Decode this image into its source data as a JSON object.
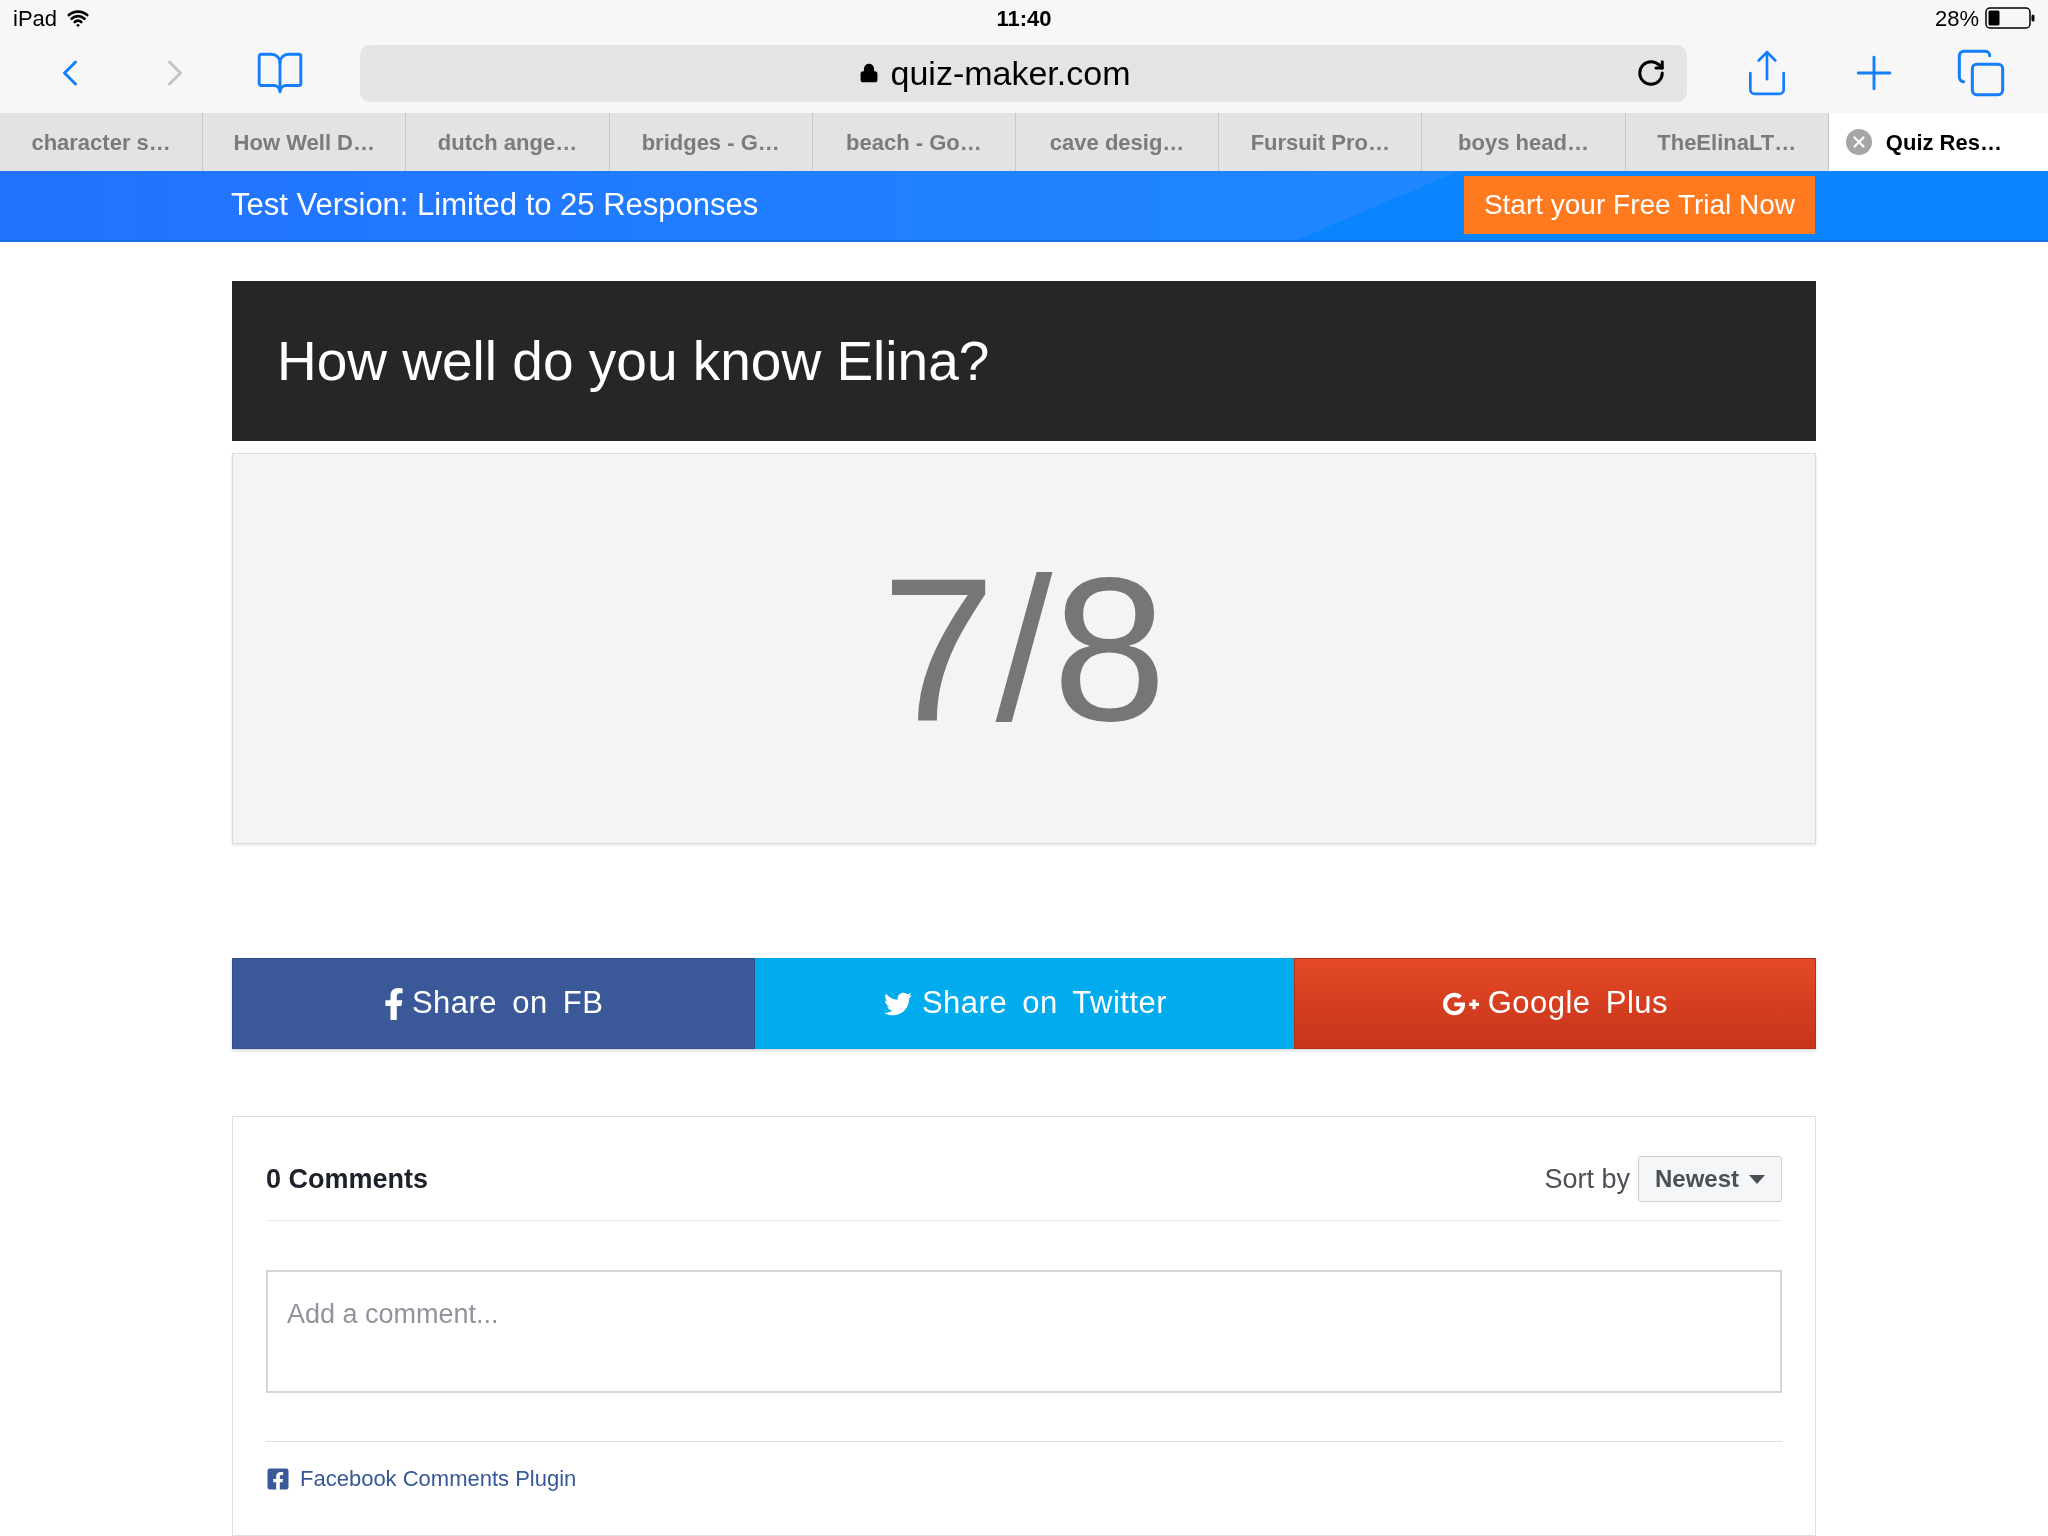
{
  "status_bar": {
    "device": "iPad",
    "time": "11:40",
    "battery": "28%"
  },
  "toolbar": {
    "nav": [
      {
        "kind": "back",
        "disabled": false
      },
      {
        "kind": "forward",
        "disabled": true
      }
    ],
    "url": "quiz-maker.com"
  },
  "tabs": [
    {
      "label": "character s…",
      "selected": false
    },
    {
      "label": "How Well D…",
      "selected": false
    },
    {
      "label": "dutch ange…",
      "selected": false
    },
    {
      "label": "bridges - G…",
      "selected": false
    },
    {
      "label": "beach - Go…",
      "selected": false
    },
    {
      "label": "cave desig…",
      "selected": false
    },
    {
      "label": "Fursuit Pro…",
      "selected": false
    },
    {
      "label": "boys head…",
      "selected": false
    },
    {
      "label": "TheElinaLT…",
      "selected": false
    },
    {
      "label": "Quiz Res…",
      "selected": true
    }
  ],
  "banner": {
    "text": "Test Version: Limited to 25 Responses",
    "button": "Start your Free Trial Now"
  },
  "quiz": {
    "title": "How well do you know Elina?",
    "score": "7/8"
  },
  "share_buttons": [
    {
      "kind": "facebook",
      "label": "Share on FB"
    },
    {
      "kind": "twitter",
      "label": "Share on Twitter"
    },
    {
      "kind": "google",
      "label": "Google Plus"
    }
  ],
  "comments": {
    "count": "0 Comments",
    "sort_label": "Sort by",
    "sort_value": "Newest",
    "placeholder": "Add a comment...",
    "plugin": "Facebook Comments Plugin"
  }
}
